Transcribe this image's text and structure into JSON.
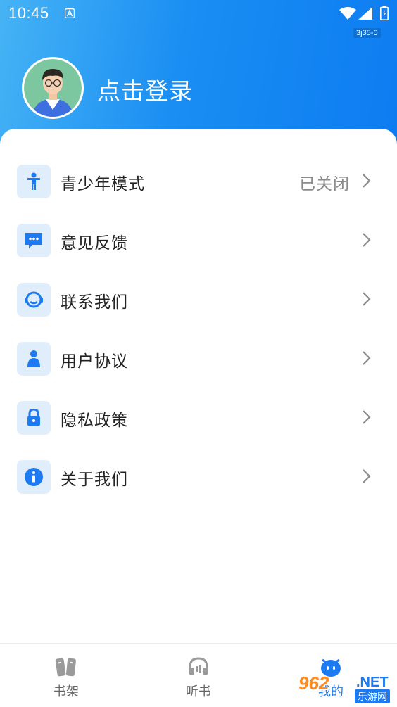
{
  "status_bar": {
    "time": "10:45",
    "build_tag": "3j35-0"
  },
  "profile": {
    "login_text": "点击登录"
  },
  "menu": [
    {
      "label": "青少年模式",
      "value": "已关闭",
      "icon": "child-icon"
    },
    {
      "label": "意见反馈",
      "value": "",
      "icon": "chat-icon"
    },
    {
      "label": "联系我们",
      "value": "",
      "icon": "headset-icon"
    },
    {
      "label": "用户协议",
      "value": "",
      "icon": "user-icon"
    },
    {
      "label": "隐私政策",
      "value": "",
      "icon": "lock-icon"
    },
    {
      "label": "关于我们",
      "value": "",
      "icon": "info-icon"
    }
  ],
  "tabs": [
    {
      "label": "书架",
      "icon": "bookshelf-icon"
    },
    {
      "label": "听书",
      "icon": "headphones-icon"
    },
    {
      "label": "我的",
      "icon": "mascot-icon",
      "active": true
    }
  ],
  "watermark": {
    "number": "962",
    "domain": ".NET",
    "sub": "乐游网"
  },
  "colors": {
    "accent": "#1d7af0",
    "header_start": "#46b3f4",
    "header_end": "#0d7cf1",
    "icon_bg": "#e0edfb"
  }
}
